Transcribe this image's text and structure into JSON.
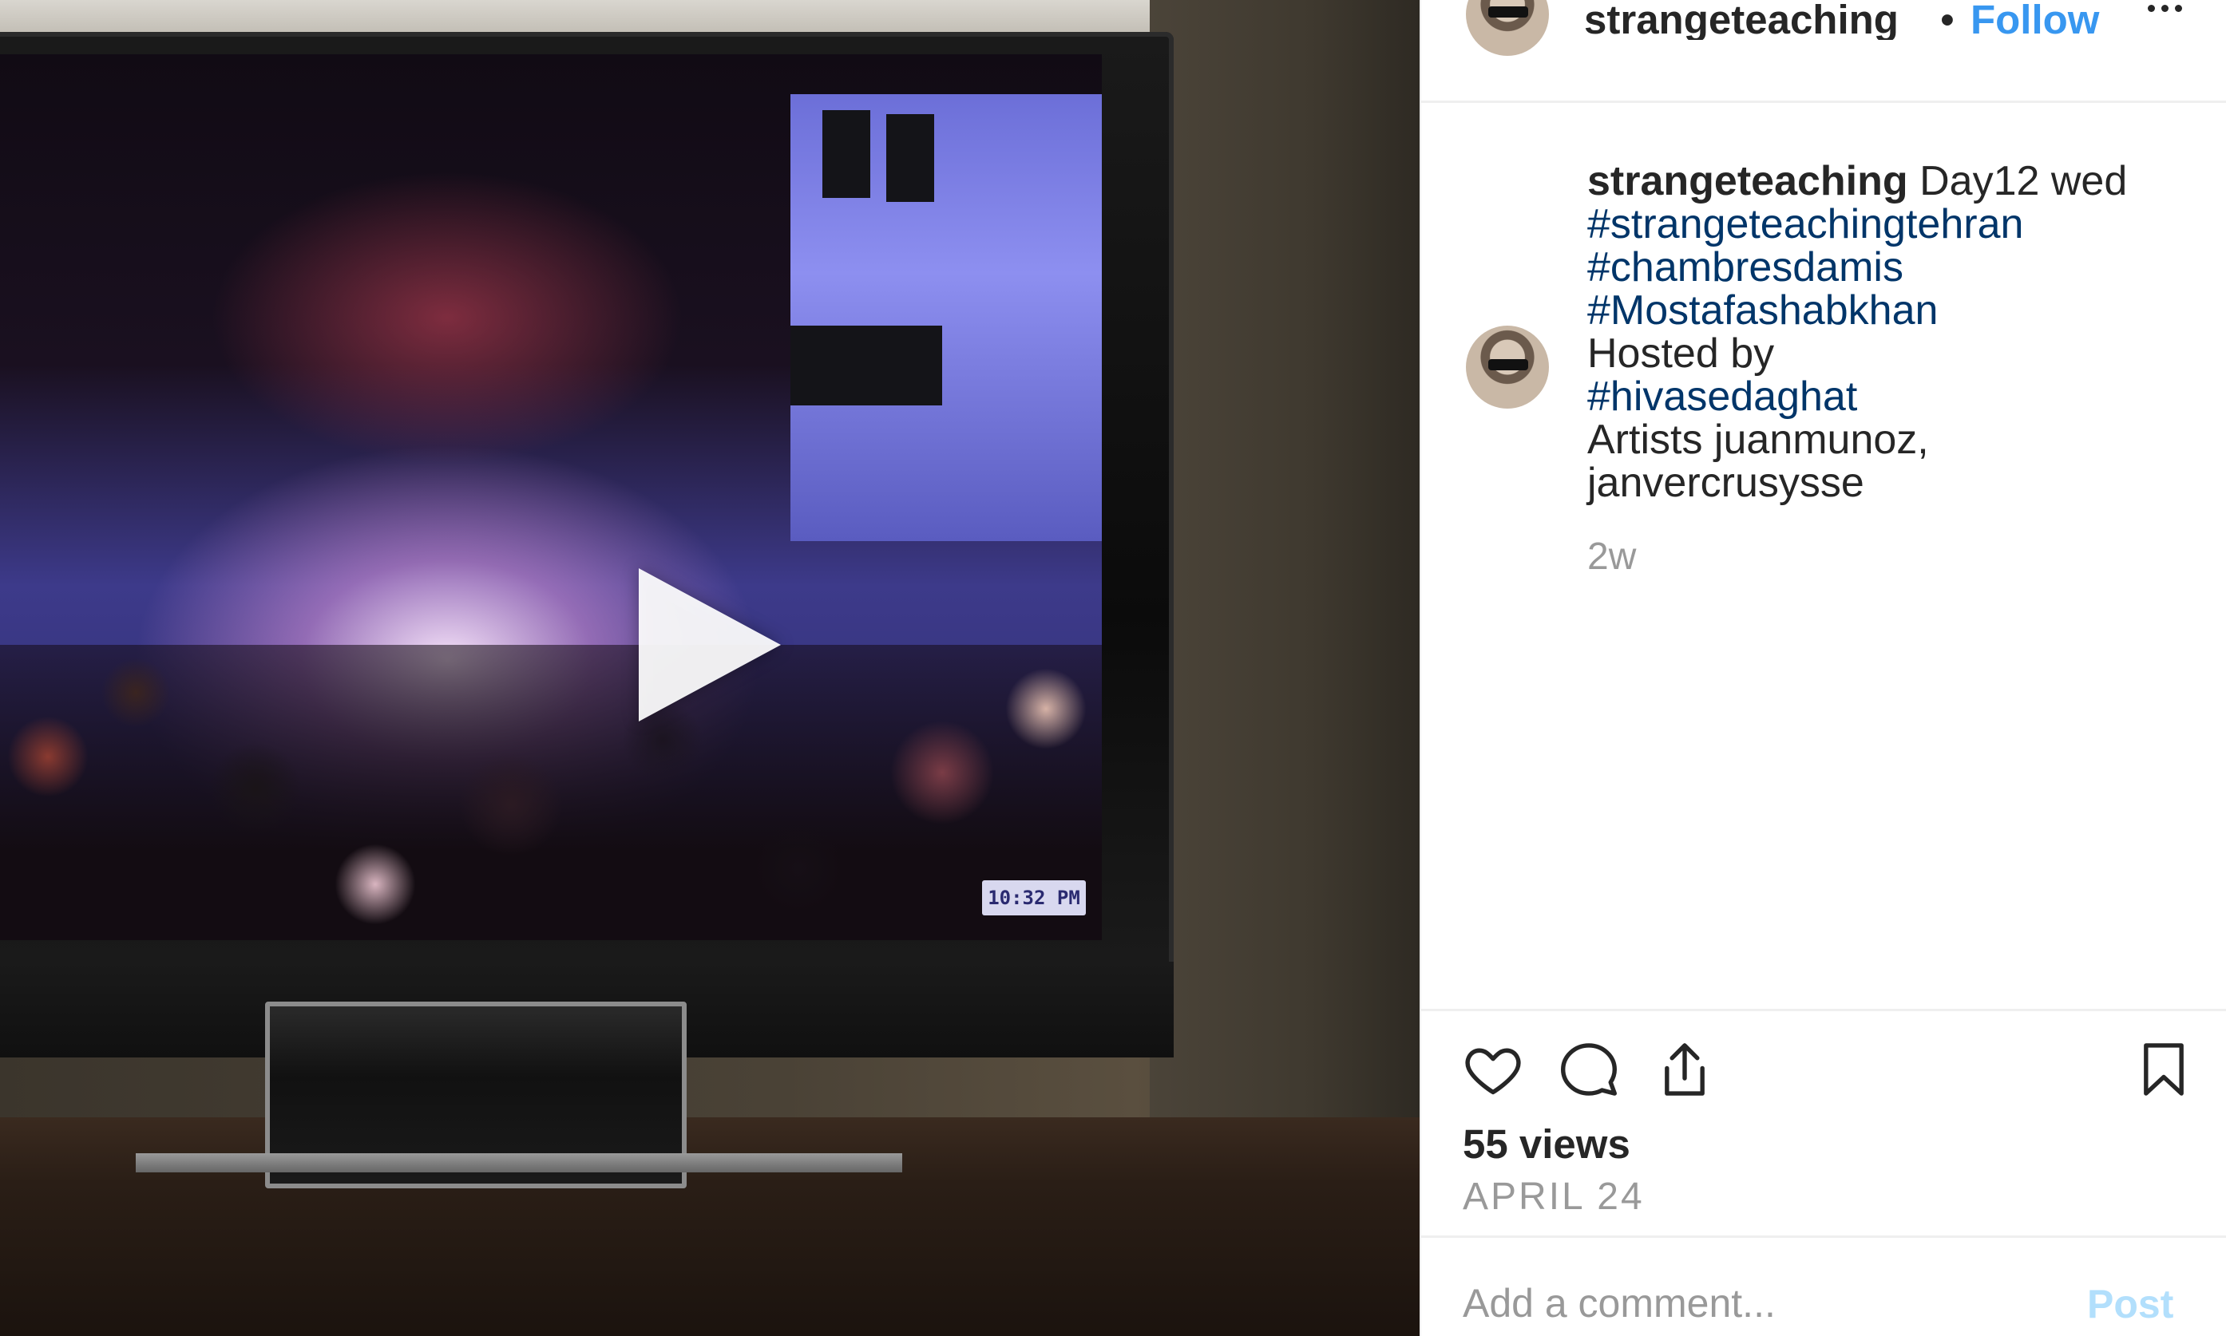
{
  "post": {
    "username": "strangeteaching",
    "bullet": "•",
    "follow_label": "Follow",
    "more_icon": "more-horizontal-icon",
    "play_icon": "play-icon",
    "video_timestamp": "10:32 PM"
  },
  "caption": {
    "username": "strangeteaching",
    "lines": [
      "Day12 wed",
      "#strangeteachingtehran",
      "#chambresdamis",
      "#Mostafashabkhan",
      "Hosted by",
      "#hivasedaghat",
      "Artists juanmunoz,",
      "janvercrusysse"
    ],
    "age": "2w"
  },
  "actions": {
    "like_icon": "heart-icon",
    "comment_icon": "comment-icon",
    "share_icon": "share-icon",
    "save_icon": "bookmark-icon",
    "views": "55 views",
    "date": "APRIL 24"
  },
  "comment": {
    "placeholder": "Add a comment...",
    "post_label": "Post"
  },
  "colors": {
    "link_blue": "#3897f0",
    "hashtag_blue": "#003569",
    "text": "#262626",
    "muted": "#999999",
    "post_disabled": "#b2dffc"
  }
}
